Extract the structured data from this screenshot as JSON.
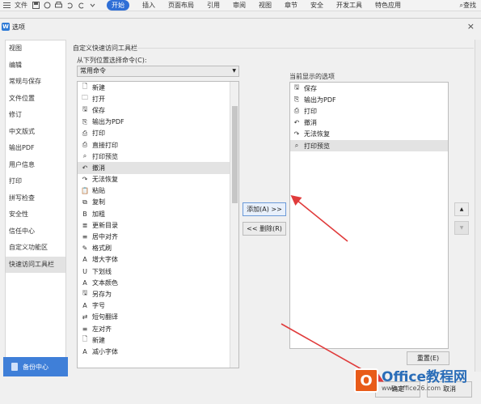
{
  "ribbon": {
    "menu_label": "文件",
    "tabs": [
      "开始",
      "插入",
      "页面布局",
      "引用",
      "审阅",
      "视图",
      "章节",
      "安全",
      "开发工具",
      "特色应用"
    ],
    "active_tab": "开始",
    "search_label": "查找"
  },
  "dialog": {
    "title": "选项",
    "close_symbol": "×",
    "logo_letter": "W"
  },
  "nav": {
    "items": [
      "视图",
      "编辑",
      "常规与保存",
      "文件位置",
      "修订",
      "中文版式",
      "输出PDF",
      "用户信息",
      "打印",
      "拼写检查",
      "安全性",
      "信任中心",
      "自定义功能区",
      "快速访问工具栏"
    ],
    "selected": "快速访问工具栏"
  },
  "backup": {
    "label": "备份中心"
  },
  "main": {
    "section_title": "自定义快速访问工具栏",
    "from_label": "从下列位置选择命令(C):",
    "combo_value": "常用命令",
    "commands": [
      {
        "label": "新建",
        "icon": "new-doc-icon"
      },
      {
        "label": "打开",
        "icon": "folder-icon"
      },
      {
        "label": "保存",
        "icon": "save-icon"
      },
      {
        "label": "输出为PDF",
        "icon": "pdf-icon"
      },
      {
        "label": "打印",
        "icon": "print-icon"
      },
      {
        "label": "直接打印",
        "icon": "direct-print-icon"
      },
      {
        "label": "打印预览",
        "icon": "print-preview-icon"
      },
      {
        "label": "撤消",
        "icon": "undo-icon"
      },
      {
        "label": "无法恢复",
        "icon": "redo-icon"
      },
      {
        "label": "粘贴",
        "icon": "paste-icon"
      },
      {
        "label": "复制",
        "icon": "copy-icon"
      },
      {
        "label": "加粗",
        "icon": "bold-icon"
      },
      {
        "label": "更新目录",
        "icon": "update-toc-icon"
      },
      {
        "label": "居中对齐",
        "icon": "align-center-icon"
      },
      {
        "label": "格式刷",
        "icon": "format-painter-icon"
      },
      {
        "label": "增大字体",
        "icon": "grow-font-icon"
      },
      {
        "label": "下划线",
        "icon": "underline-icon"
      },
      {
        "label": "文本颜色",
        "icon": "font-color-icon"
      },
      {
        "label": "另存为",
        "icon": "save-as-icon"
      },
      {
        "label": "字号",
        "icon": "font-size-icon"
      },
      {
        "label": "短句翻译",
        "icon": "translate-icon"
      },
      {
        "label": "左对齐",
        "icon": "align-left-icon"
      },
      {
        "label": "新建",
        "icon": "new-doc-icon"
      },
      {
        "label": "减小字体",
        "icon": "shrink-font-icon"
      }
    ],
    "selected_command": "撤消",
    "add_label": "添加(A) >>",
    "remove_label": "<< 删除(R)",
    "current_label": "当前显示的选项",
    "current_items": [
      {
        "label": "保存",
        "icon": "save-icon"
      },
      {
        "label": "输出为PDF",
        "icon": "pdf-icon"
      },
      {
        "label": "打印",
        "icon": "print-icon"
      },
      {
        "label": "撤消",
        "icon": "undo-icon"
      },
      {
        "label": "无法恢复",
        "icon": "redo-icon"
      },
      {
        "label": "打印预览",
        "icon": "print-preview-icon"
      }
    ],
    "selected_current": "打印预览",
    "up_symbol": "▲",
    "down_symbol": "▼",
    "reset_label": "重置(E)"
  },
  "footer": {
    "ok_label": "确定",
    "cancel_label": "取消"
  },
  "watermark": {
    "logo_letter": "O",
    "title": "Office教程网",
    "url": "www.office26.com"
  },
  "colors": {
    "accent": "#2f6fd6",
    "backup_bg": "#3f7fd8",
    "arrow": "#e03b3b",
    "watermark_orange": "#e85b19"
  }
}
